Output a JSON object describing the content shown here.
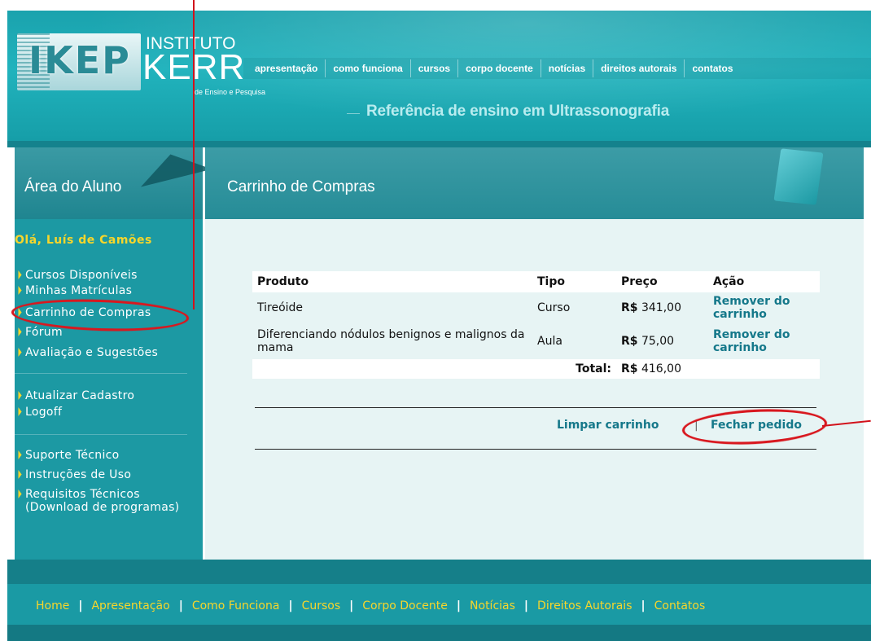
{
  "header": {
    "logo": {
      "mark": "IKEP",
      "line1": "INSTITUTO",
      "line2": "KERR",
      "line3": "de Ensino e Pesquisa"
    },
    "nav": [
      "apresentação",
      "como funciona",
      "cursos",
      "corpo docente",
      "notícias",
      "direitos autorais",
      "contatos"
    ],
    "tagline": "Referência de ensino em Ultrassonografia"
  },
  "sidebar": {
    "title": "Área do Aluno",
    "greeting": "Olá, Luís de Camões",
    "group1": [
      "Cursos Disponíveis",
      "Minhas Matrículas",
      "Carrinho de Compras",
      "Fórum",
      "Avaliação e Sugestões"
    ],
    "group2": [
      "Atualizar Cadastro",
      "Logoff"
    ],
    "group3": [
      "Suporte Técnico",
      "Instruções de Uso",
      "Requisitos Técnicos (Download de programas)"
    ]
  },
  "main": {
    "title": "Carrinho de Compras",
    "table": {
      "headers": [
        "Produto",
        "Tipo",
        "Preço",
        "Ação"
      ],
      "rows": [
        {
          "produto": "Tireóide",
          "tipo": "Curso",
          "currency": "R$",
          "preco": "341,00",
          "acao": "Remover do carrinho"
        },
        {
          "produto": "Diferenciando nódulos benignos e malignos da mama",
          "tipo": "Aula",
          "currency": "R$",
          "preco": "75,00",
          "acao": "Remover do carrinho"
        }
      ],
      "total_label": "Total:",
      "total_currency": "R$",
      "total_value": "416,00"
    },
    "actions": {
      "clear": "Limpar carrinho",
      "separator": "|",
      "close": "Fechar pedido"
    }
  },
  "footer": {
    "links": [
      "Home",
      "Apresentação",
      "Como Funciona",
      "Cursos",
      "Corpo Docente",
      "Notícias",
      "Direitos Autorais",
      "Contatos"
    ],
    "separator": "|"
  },
  "colors": {
    "accent": "#1a9aa4",
    "highlight": "#f7d62b",
    "link": "#15788a",
    "annotation": "#d2121b"
  }
}
